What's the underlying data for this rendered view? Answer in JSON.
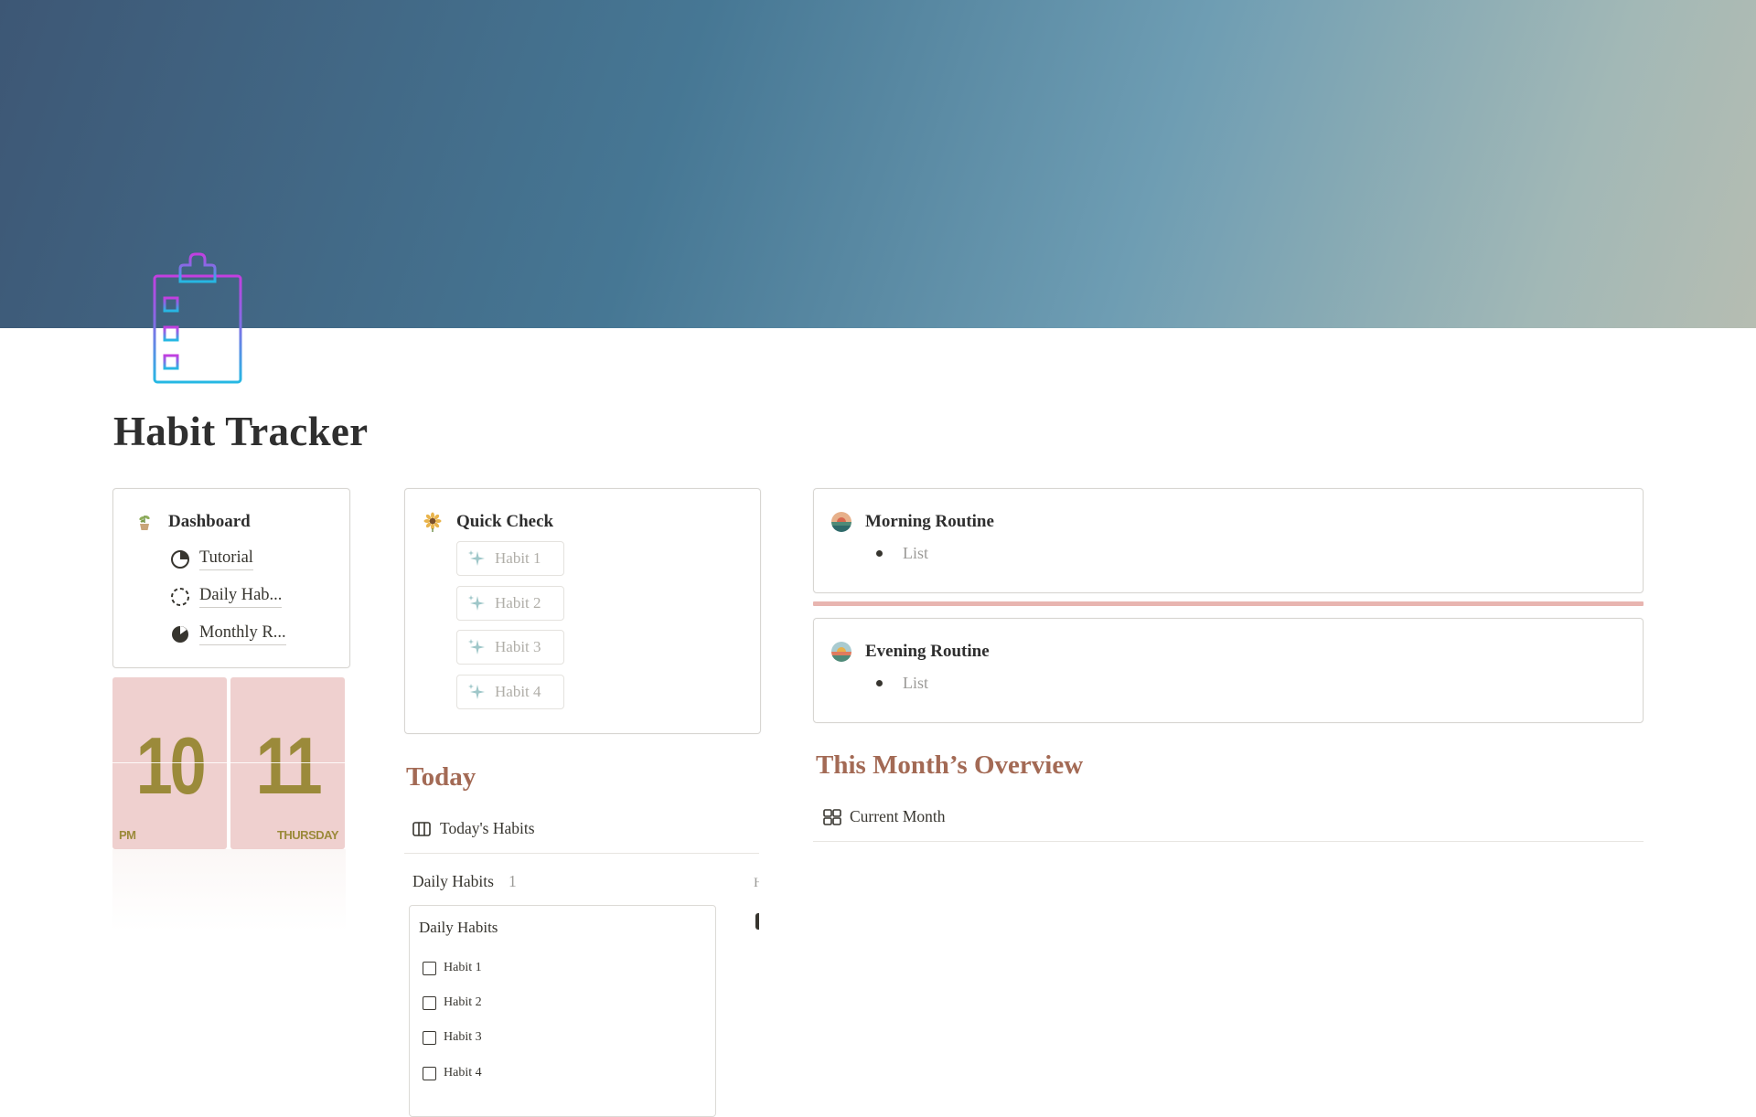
{
  "page": {
    "title": "Habit Tracker"
  },
  "dashboard": {
    "title": "Dashboard",
    "links": [
      {
        "label": "Tutorial",
        "icon": "pie-chart-icon"
      },
      {
        "label": "Daily Hab...",
        "icon": "dashed-circle-icon"
      },
      {
        "label": "Monthly R...",
        "icon": "moon-pie-icon"
      }
    ]
  },
  "clock": {
    "hour": "10",
    "minute": "11",
    "ampm": "PM",
    "weekday": "THURSDAY"
  },
  "quick_check": {
    "title": "Quick Check",
    "buttons": [
      "Habit 1",
      "Habit 2",
      "Habit 3",
      "Habit 4"
    ]
  },
  "today": {
    "heading": "Today",
    "view_tab": "Today's Habits",
    "group_name": "Daily Habits",
    "group_count": "1",
    "card_title": "Daily Habits",
    "habits": [
      "Habit 1",
      "Habit 2",
      "Habit 3",
      "Habit 4"
    ]
  },
  "morning": {
    "title": "Morning Routine",
    "item": "List"
  },
  "evening": {
    "title": "Evening Routine",
    "item": "List"
  },
  "overview": {
    "heading": "This Month’s Overview",
    "view_tab": "Current Month"
  },
  "colors": {
    "heading_accent": "#a36a55",
    "clock_bg": "#efd0cf",
    "clock_text": "#9b8a3a",
    "divider_pink": "#e8b5b0"
  }
}
